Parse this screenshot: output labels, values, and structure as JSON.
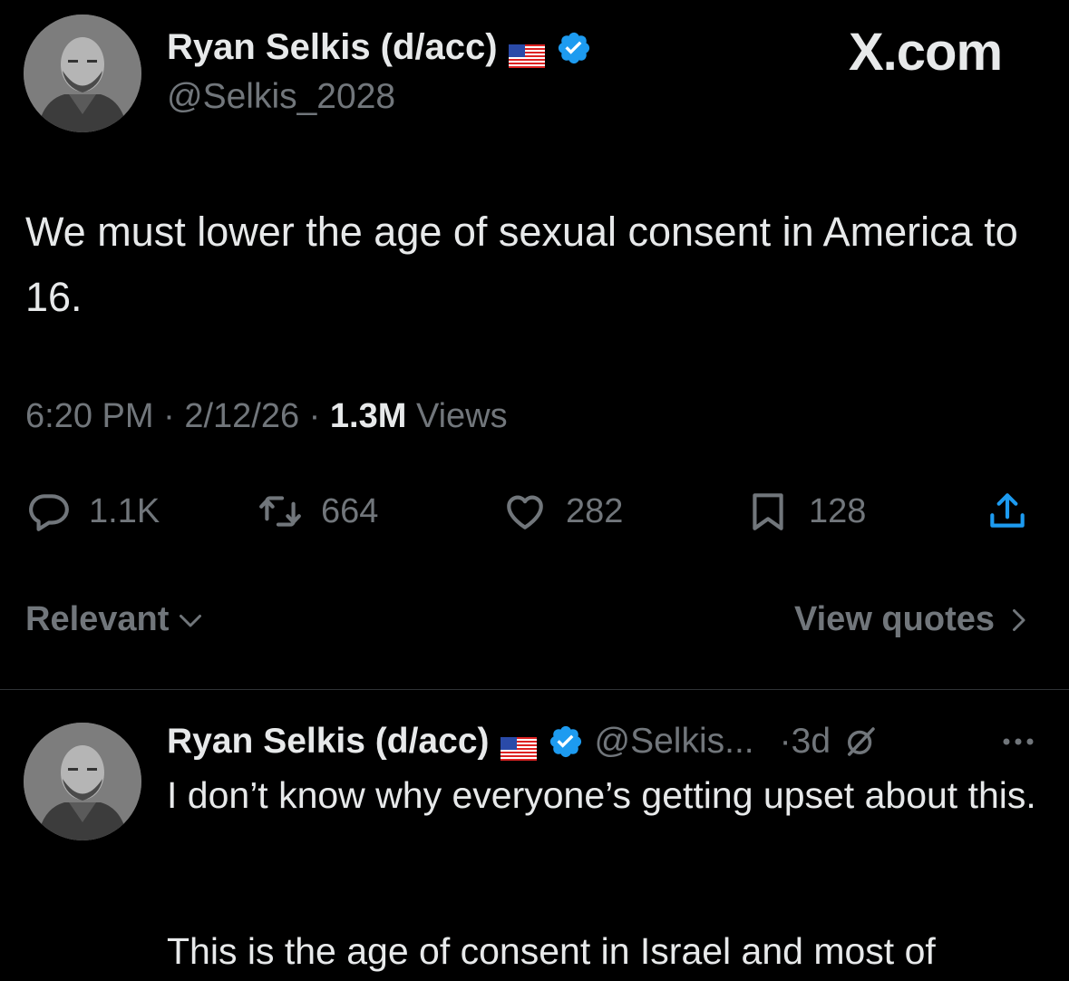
{
  "brand": {
    "label": "X.com"
  },
  "tweet": {
    "author": {
      "name": "Ryan Selkis (d/acc)",
      "handle": "@Selkis_2028",
      "flag_icon": "us-flag-icon",
      "verified_icon": "verified-badge-icon"
    },
    "text": "We must lower the age of sexual consent in America to 16.",
    "meta": {
      "time": "6:20 PM",
      "separator": "·",
      "date": "2/12/26",
      "views_count": "1.3M",
      "views_label": "Views"
    },
    "actions": {
      "replies": "1.1K",
      "reposts": "664",
      "likes": "282",
      "bookmarks": "128"
    }
  },
  "sort": {
    "label": "Relevant",
    "view_quotes": "View quotes"
  },
  "reply": {
    "name": "Ryan Selkis (d/acc)",
    "handle": "@Selkis...",
    "time": "·3d",
    "text_line1": "I don’t know why everyone’s getting upset about this.",
    "text_line2": "This is the age of consent in Israel and most of"
  },
  "colors": {
    "background": "#000000",
    "text": "#e7e9ea",
    "muted": "#71767b",
    "verified": "#1d9bf0"
  }
}
